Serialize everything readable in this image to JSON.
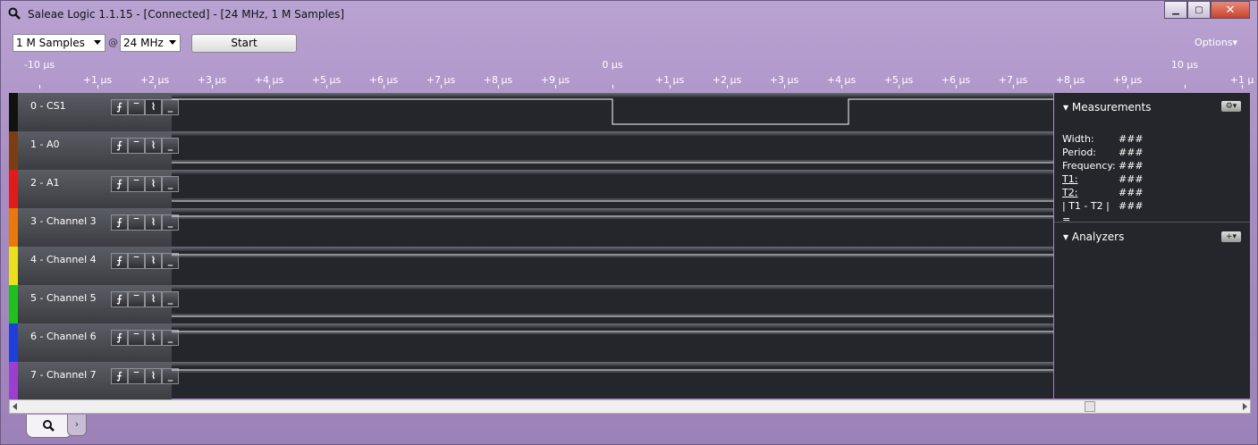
{
  "window": {
    "title": "Saleae Logic 1.1.15 - [Connected] - [24 MHz, 1 M Samples]",
    "min_label": "▁",
    "max_label": "▢",
    "close_label": "✕"
  },
  "toolbar": {
    "samples_value": "1 M Samples",
    "at_symbol": "@",
    "rate_value": "24 MHz",
    "start_label": "Start",
    "options_label": "Options▾"
  },
  "ruler": {
    "major_left": "-10 µs",
    "major_center": "0 µs",
    "major_right": "10 µs",
    "minor_ticks": [
      "+1 µs",
      "+2 µs",
      "+3 µs",
      "+4 µs",
      "+5 µs",
      "+6 µs",
      "+7 µs",
      "+8 µs",
      "+9 µs",
      "+1 µs",
      "+2 µs",
      "+3 µs",
      "+4 µs",
      "+5 µs",
      "+6 µs",
      "+7 µs",
      "+8 µs",
      "+9 µs",
      "+1 µ"
    ]
  },
  "channels": [
    {
      "label": "0 - CS1",
      "color": "#111111",
      "signal": "pulse",
      "active_trigger": 2
    },
    {
      "label": "1 - A0",
      "color": "#7a3e12",
      "signal": "low"
    },
    {
      "label": "2 - A1",
      "color": "#e01b1b",
      "signal": "low"
    },
    {
      "label": "3 - Channel 3",
      "color": "#e8790f",
      "signal": "high"
    },
    {
      "label": "4 - Channel 4",
      "color": "#e8e020",
      "signal": "high"
    },
    {
      "label": "5 - Channel 5",
      "color": "#20c020",
      "signal": "low"
    },
    {
      "label": "6 - Channel 6",
      "color": "#1f3fd8",
      "signal": "high"
    },
    {
      "label": "7 - Channel 7",
      "color": "#9a3fd0",
      "signal": "high"
    }
  ],
  "trigger_buttons": [
    "⨍",
    "‾",
    "⌇",
    "_"
  ],
  "measurements": {
    "header": "Measurements",
    "rows": [
      {
        "key": "Width:",
        "value": "###"
      },
      {
        "key": "Period:",
        "value": "###"
      },
      {
        "key": "Frequency:",
        "value": "###"
      },
      {
        "key": "T1:",
        "value": "###"
      },
      {
        "key": "T2:",
        "value": "###"
      },
      {
        "key": "| T1 - T2 | =",
        "value": "###"
      }
    ]
  },
  "analyzers": {
    "header": "Analyzers",
    "add_label": "+▾"
  },
  "tabs": {
    "search_tab": "⚲",
    "next_tab": "›"
  }
}
